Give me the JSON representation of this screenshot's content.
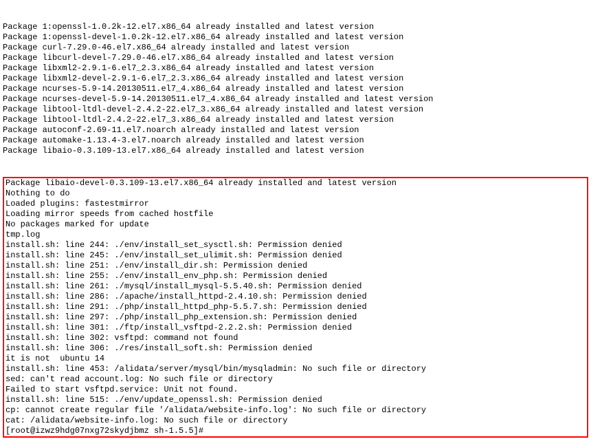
{
  "preLines": [
    "Package 1:openssl-1.0.2k-12.el7.x86_64 already installed and latest version",
    "Package 1:openssl-devel-1.0.2k-12.el7.x86_64 already installed and latest version",
    "Package curl-7.29.0-46.el7.x86_64 already installed and latest version",
    "Package libcurl-devel-7.29.0-46.el7.x86_64 already installed and latest version",
    "Package libxml2-2.9.1-6.el7_2.3.x86_64 already installed and latest version",
    "Package libxml2-devel-2.9.1-6.el7_2.3.x86_64 already installed and latest version",
    "Package ncurses-5.9-14.20130511.el7_4.x86_64 already installed and latest version",
    "Package ncurses-devel-5.9-14.20130511.el7_4.x86_64 already installed and latest version",
    "Package libtool-ltdl-devel-2.4.2-22.el7_3.x86_64 already installed and latest version",
    "Package libtool-ltdl-2.4.2-22.el7_3.x86_64 already installed and latest version",
    "Package autoconf-2.69-11.el7.noarch already installed and latest version",
    "Package automake-1.13.4-3.el7.noarch already installed and latest version",
    "Package libaio-0.3.109-13.el7.x86_64 already installed and latest version"
  ],
  "boxLines": [
    "Package libaio-devel-0.3.109-13.el7.x86_64 already installed and latest version",
    "Nothing to do",
    "Loaded plugins: fastestmirror",
    "Loading mirror speeds from cached hostfile",
    "No packages marked for update",
    "tmp.log",
    "install.sh: line 244: ./env/install_set_sysctl.sh: Permission denied",
    "install.sh: line 245: ./env/install_set_ulimit.sh: Permission denied",
    "install.sh: line 251: ./env/install_dir.sh: Permission denied",
    "install.sh: line 255: ./env/install_env_php.sh: Permission denied",
    "install.sh: line 261: ./mysql/install_mysql-5.5.40.sh: Permission denied",
    "install.sh: line 286: ./apache/install_httpd-2.4.10.sh: Permission denied",
    "install.sh: line 291: ./php/install_httpd_php-5.5.7.sh: Permission denied",
    "install.sh: line 297: ./php/install_php_extension.sh: Permission denied",
    "install.sh: line 301: ./ftp/install_vsftpd-2.2.2.sh: Permission denied",
    "install.sh: line 302: vsftpd: command not found",
    "install.sh: line 306: ./res/install_soft.sh: Permission denied",
    "it is not  ubuntu 14",
    "install.sh: line 453: /alidata/server/mysql/bin/mysqladmin: No such file or directory",
    "sed: can't read account.log: No such file or directory",
    "Failed to start vsftpd.service: Unit not found.",
    "install.sh: line 515: ./env/update_openssl.sh: Permission denied",
    "cp: cannot create regular file '/alidata/website-info.log': No such file or directory",
    "cat: /alidata/website-info.log: No such file or directory",
    "[root@izwz9hdg07nxg72skydjbmz sh-1.5.5]#"
  ]
}
